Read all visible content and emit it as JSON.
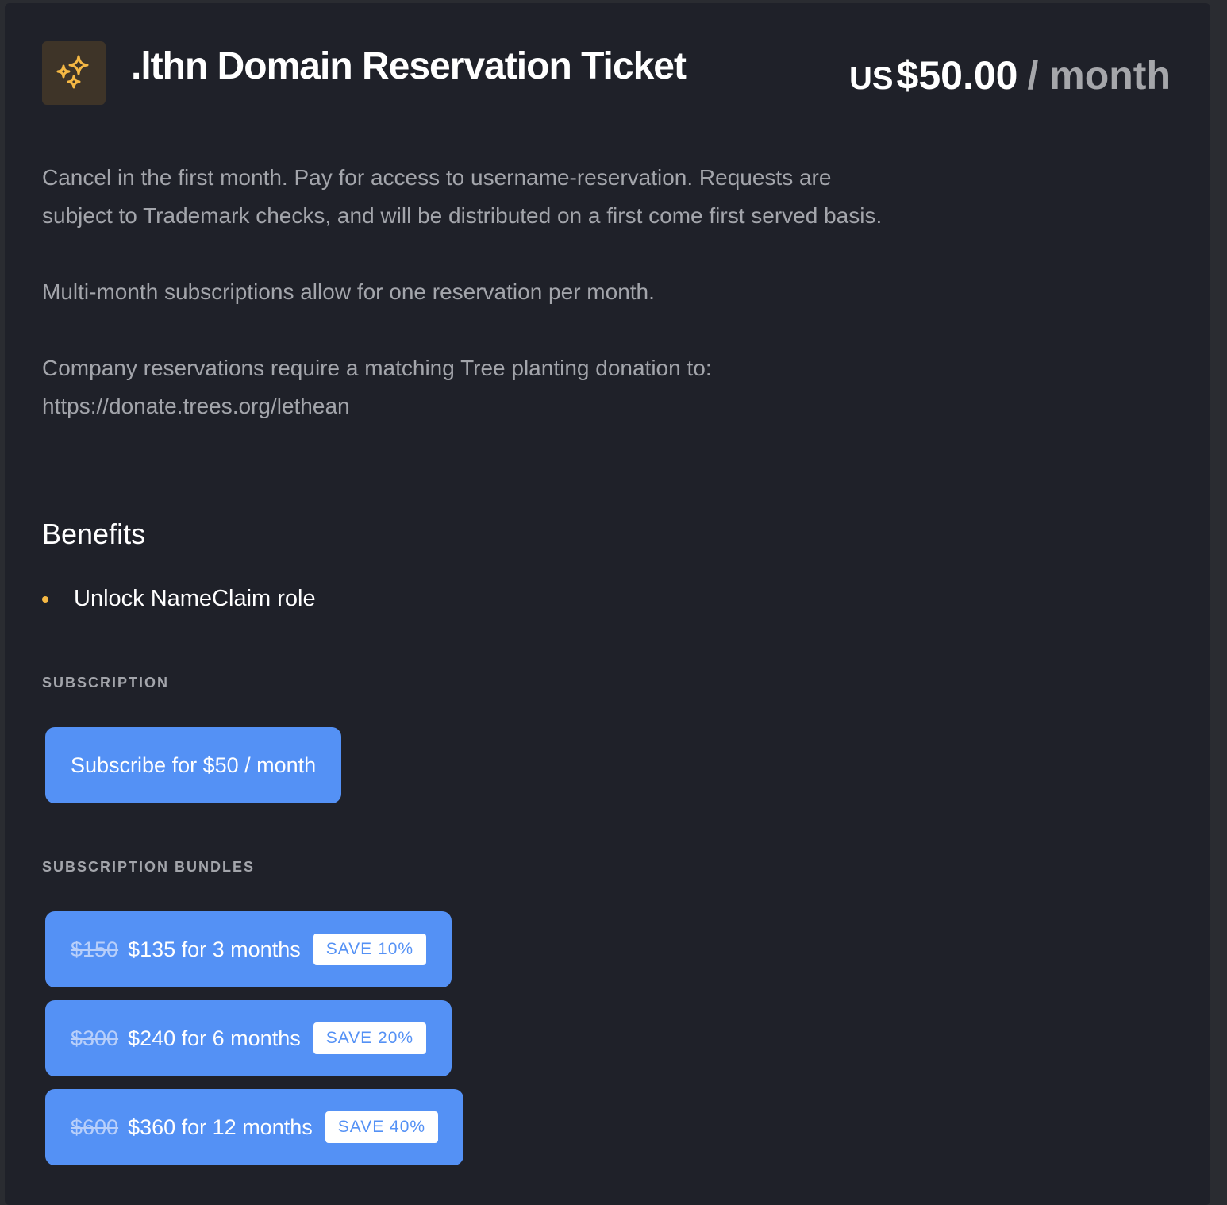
{
  "header": {
    "icon": "sparkles-icon",
    "title": ".lthn Domain Reservation Ticket",
    "price_currency": "US",
    "price_amount": "$50.00",
    "price_period": "/ month"
  },
  "description": [
    "Cancel in the first month. Pay for access to username-reservation. Requests are subject to Trademark checks, and will be distributed on a first come first served basis.",
    "Multi-month subscriptions allow for one reservation per month.",
    "Company reservations require a matching Tree planting donation to: https://donate.trees.org/lethean"
  ],
  "benefits": {
    "heading": "Benefits",
    "items": [
      {
        "label": "Unlock NameClaim role"
      }
    ]
  },
  "subscription": {
    "label": "SUBSCRIPTION",
    "button_label": "Subscribe for $50 / month"
  },
  "bundles": {
    "label": "SUBSCRIPTION BUNDLES",
    "items": [
      {
        "old_price": "$150",
        "label": "$135 for 3 months",
        "badge": "SAVE 10%"
      },
      {
        "old_price": "$300",
        "label": "$240 for 6 months",
        "badge": "SAVE 20%"
      },
      {
        "old_price": "$600",
        "label": "$360 for 12 months",
        "badge": "SAVE 40%"
      }
    ]
  },
  "colors": {
    "background": "#1f2129",
    "accent": "#5491f5",
    "bullet": "#f5b844",
    "icon": "#f5b844"
  }
}
